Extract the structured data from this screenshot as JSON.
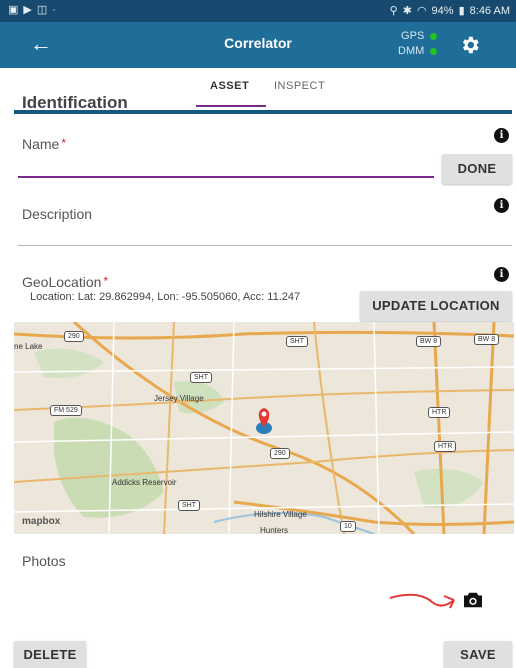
{
  "status_bar": {
    "left_icons": [
      "gallery-icon",
      "play-icon",
      "screenshot-icon",
      "dot-icon"
    ],
    "battery": "94%",
    "time": "8:46 AM"
  },
  "app_bar": {
    "title": "Correlator",
    "gps_label": "GPS",
    "dmm_label": "DMM",
    "gps_status_color": "#23c223",
    "dmm_status_color": "#23c223"
  },
  "tabs": [
    "ASSET",
    "INSPECT"
  ],
  "active_tab": "ASSET",
  "section_title": "Identification",
  "form": {
    "name_label": "Name",
    "name_required": "*",
    "name_value": "",
    "done_button": "DONE",
    "description_label": "Description",
    "description_value": "",
    "geolocation_label": "GeoLocation",
    "geolocation_required": "*",
    "location_text": "Location: Lat: 29.862994, Lon: -95.505060, Acc: 11.247",
    "update_location_button": "UPDATE LOCATION",
    "photos_label": "Photos",
    "info_glyph": "i"
  },
  "map": {
    "labels": {
      "ne_lake": "ne Lake",
      "jersey_village": "Jersey Village",
      "addicks_reservoir": "Addicks Reservoir",
      "hilshire_village": "Hilshire Village",
      "hunters": "Hunters",
      "mapbox": "mapbox"
    },
    "shields": [
      "290",
      "SHT",
      "BW 8",
      "BW 8",
      "SHT",
      "FM 529",
      "HTR",
      "HTR",
      "290",
      "SHT",
      "10"
    ]
  },
  "actions": {
    "delete_button": "DELETE",
    "save_button": "SAVE"
  },
  "colors": {
    "status_bar": "#174a6e",
    "app_bar": "#1f6d99",
    "accent": "#7a2a8a",
    "required": "#c62828",
    "section_rule": "#13587f",
    "marker": "#e53935"
  }
}
